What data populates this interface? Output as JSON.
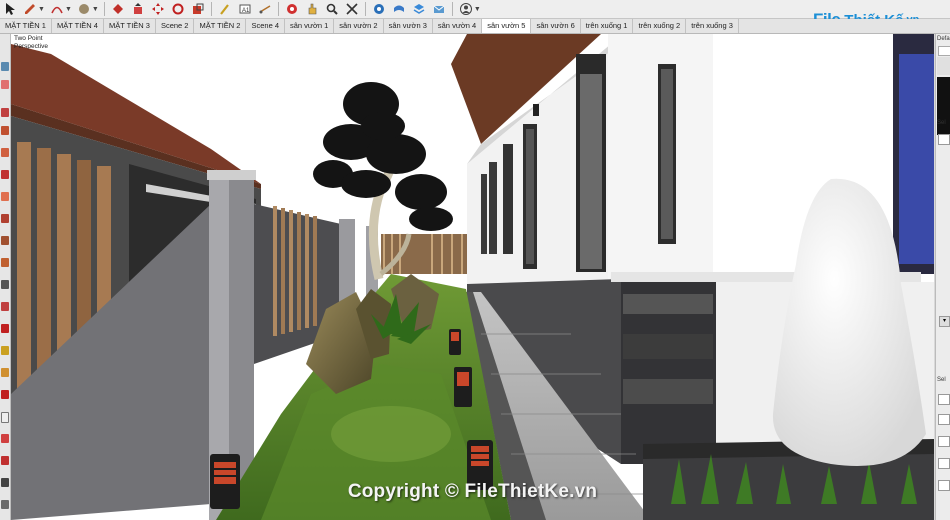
{
  "tabs": [
    {
      "label": "MẶT TIỀN 1"
    },
    {
      "label": "MẶT TIỀN 4"
    },
    {
      "label": "MẶT TIỀN 3"
    },
    {
      "label": "Scene 2"
    },
    {
      "label": "MẶT TIỀN 2"
    },
    {
      "label": "Scene 4"
    },
    {
      "label": "sân vườn 1"
    },
    {
      "label": "sân vườn 2"
    },
    {
      "label": "sân vườn 3"
    },
    {
      "label": "sân vườn 4"
    },
    {
      "label": "sân vườn 5"
    },
    {
      "label": "sân vườn 6"
    },
    {
      "label": "trên xuống 1"
    },
    {
      "label": "trên xuống 2"
    },
    {
      "label": "trên xuống 3"
    }
  ],
  "active_tab": "sân vườn 5",
  "viewport": {
    "camera_line1": "Two Point",
    "camera_line2": "Perspective"
  },
  "watermark": "Copyright © FileThietKe.vn",
  "logo": {
    "file": "File",
    "rest": "Thiết Kế",
    "vn": ".vn"
  },
  "right_panel": {
    "title": "Defa",
    "sel1": "Sel",
    "sel2": "Sel"
  },
  "toolbar_icons": [
    "select-icon",
    "pencil-icon",
    "arc-icon",
    "eraser-icon",
    "paint-bucket-icon",
    "push-pull-icon",
    "move-icon",
    "rotate-icon",
    "scale-icon",
    "tape-measure-icon",
    "text-icon",
    "dimension-icon",
    "orbit-icon",
    "pan-icon",
    "zoom-icon",
    "zoom-extents-icon",
    "warehouse-icon",
    "extension-icon",
    "layers-icon",
    "account-icon"
  ],
  "colors": {
    "brand": "#1c8fd6",
    "sky": "#ffffff",
    "grass": "#5f8a2c",
    "wall": "#6f6f73"
  }
}
